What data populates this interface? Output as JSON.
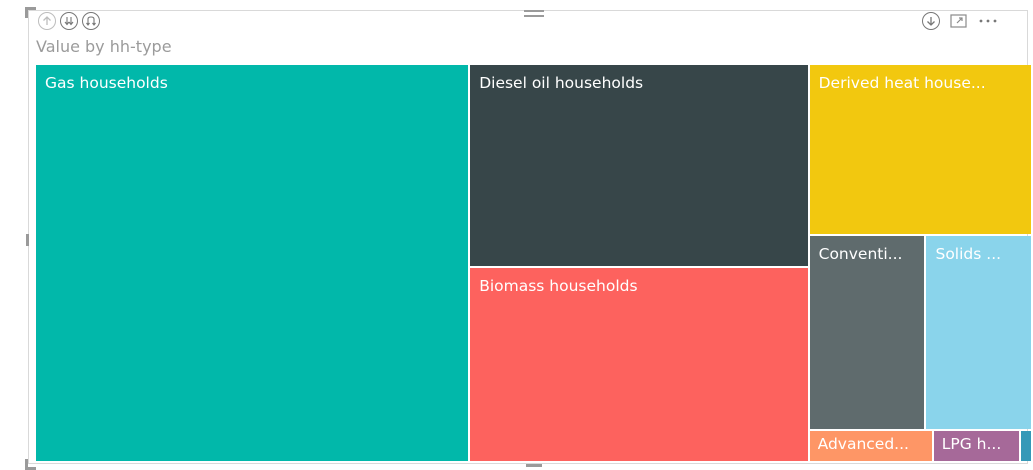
{
  "visual": {
    "title": "Value by hh-type",
    "header_icons_left": [
      "drill-up-icon",
      "expand-all-down-icon",
      "drill-down-mode-icon"
    ],
    "header_icons_right": [
      "drill-down-icon",
      "focus-mode-icon",
      "more-options-icon"
    ]
  },
  "chart_data": {
    "type": "treemap",
    "title": "Value by hh-type",
    "legend": "none",
    "items": [
      {
        "label": "Gas households",
        "color": "#01B8AA",
        "share": 0.4366
      },
      {
        "label": "Diesel oil households",
        "color": "#374649",
        "share": 0.1745
      },
      {
        "label": "Biomass households",
        "color": "#FD625E",
        "share": 0.1668
      },
      {
        "label": "Derived heat house...",
        "color": "#F2C80F",
        "share": 0.0967
      },
      {
        "label": "Conventi...",
        "color": "#5F6B6D",
        "share": 0.0575
      },
      {
        "label": "Solids ...",
        "color": "#8AD4EB",
        "share": 0.0524
      },
      {
        "label": "Advanced...",
        "color": "#FE9666",
        "share": 0.01
      },
      {
        "label": "LPG h...",
        "color": "#A66999",
        "share": 0.007
      },
      {
        "label": "",
        "color": "#3599B8",
        "share": 0.001
      }
    ]
  }
}
